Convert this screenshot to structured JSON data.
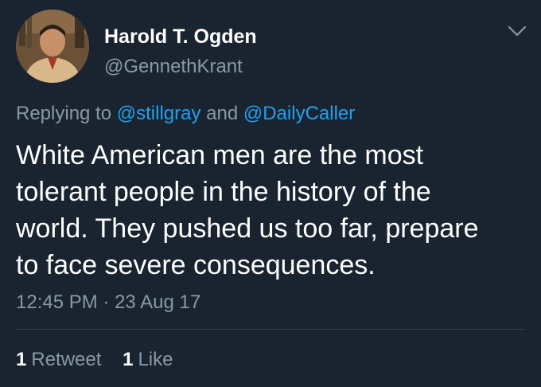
{
  "author": {
    "name": "Harold T. Ogden",
    "handle": "@GennethKrant"
  },
  "reply": {
    "prefix": "Replying to",
    "mention1": "@stillgray",
    "conjunction": "and",
    "mention2": "@DailyCaller"
  },
  "tweet": {
    "lines": [
      "White American men are the most",
      "tolerant people in the history of the",
      "world. They pushed us too far, prepare",
      "to face severe consequences."
    ]
  },
  "meta": {
    "time": "12:45 PM",
    "separator": "·",
    "date": "23 Aug 17"
  },
  "stats": {
    "retweets": {
      "count": "1",
      "label": "Retweet"
    },
    "likes": {
      "count": "1",
      "label": "Like"
    }
  },
  "icons": {
    "menu": "chevron-down-icon"
  },
  "colors": {
    "background": "#1a2430",
    "primary_text": "#ffffff",
    "secondary_text": "#8899a6",
    "link": "#1da1f2",
    "divider": "#38444d"
  }
}
